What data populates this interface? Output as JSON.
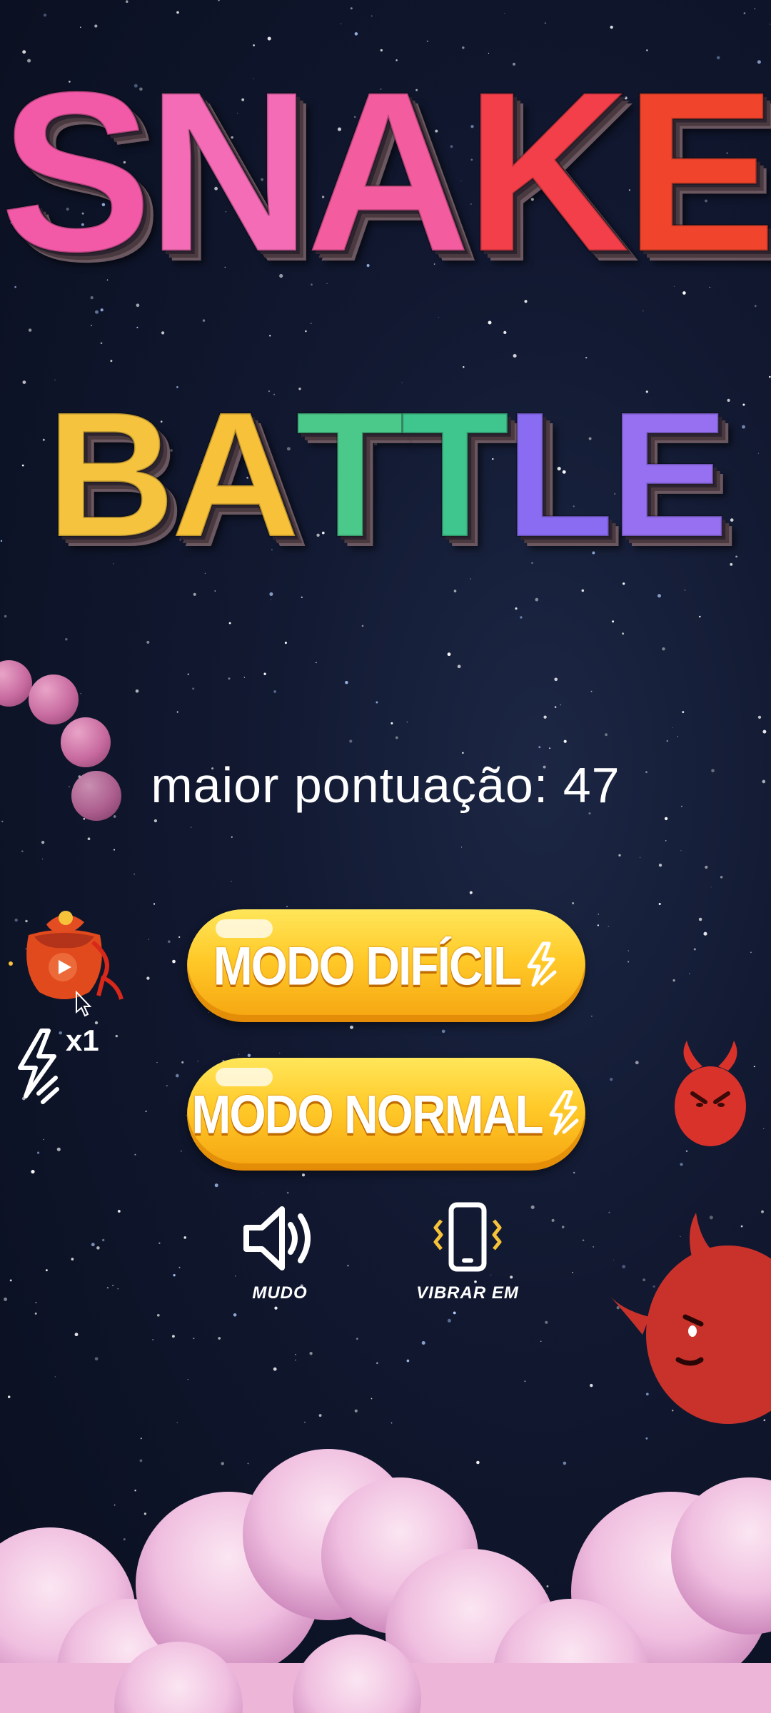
{
  "title": {
    "line1": [
      "S",
      "N",
      "A",
      "K",
      "E"
    ],
    "line1_colors": [
      "#f25aa8",
      "#f46bb6",
      "#f35c9e",
      "#f23f4a",
      "#f0442c"
    ],
    "line2": [
      "B",
      "A",
      "T",
      "T",
      "L",
      "E"
    ],
    "line2_colors": [
      "#f5c33e",
      "#f7c13a",
      "#4bc98b",
      "#3fc58e",
      "#8a6cf2",
      "#9670f0"
    ]
  },
  "high_score": {
    "label": "maior pontuação:",
    "value": "47"
  },
  "buttons": {
    "hard_label": "MODO DIFÍCIL",
    "normal_label": "MODO NORMAL"
  },
  "toggles": {
    "sound_label": "MUDO",
    "vibrate_label": "VIBRAR EM"
  },
  "energy": {
    "count": "x1"
  },
  "colors": {
    "button_yellow": "#ffc928",
    "devil_red": "#d9322b",
    "cloud_pink": "#f2c6e2",
    "snake_pink": "#c86ba0"
  },
  "icons": {
    "sound": "speaker-icon",
    "vibrate": "phone-vibrate-icon",
    "gift": "gift-bag-icon",
    "energy": "lightning-bolt-icon"
  }
}
